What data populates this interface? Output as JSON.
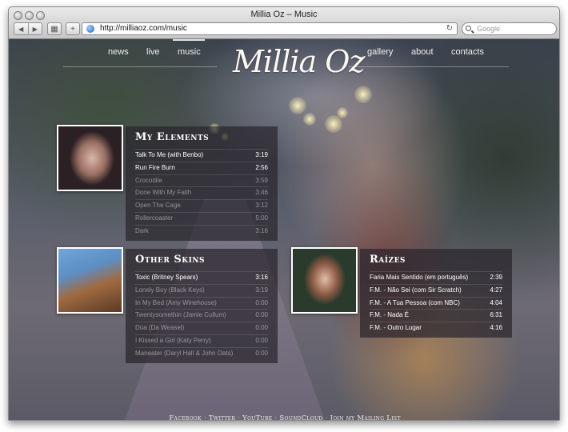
{
  "window": {
    "title": "Millia Oz – Music"
  },
  "toolbar": {
    "back_icon": "back-arrow-icon",
    "forward_icon": "forward-arrow-icon",
    "grid_icon": "grid-icon",
    "add_symbol": "+",
    "url": "http://milliaoz.com/music",
    "search_placeholder": "Google"
  },
  "site": {
    "logo": "Millia Oz",
    "nav_left": [
      "news",
      "live",
      "music"
    ],
    "nav_right": [
      "gallery",
      "about",
      "contacts"
    ],
    "active": "music"
  },
  "albums": [
    {
      "title": "My Elements",
      "tracks": [
        {
          "name": "Talk To Me (with Benbo)",
          "duration": "3:19",
          "bright": true
        },
        {
          "name": "Run Fire Burn",
          "duration": "2:56",
          "bright": true
        },
        {
          "name": "Crocodile",
          "duration": "3:59",
          "bright": false
        },
        {
          "name": "Done With My Faith",
          "duration": "3:46",
          "bright": false
        },
        {
          "name": "Open The Cage",
          "duration": "3:12",
          "bright": false
        },
        {
          "name": "Rollercoaster",
          "duration": "5:00",
          "bright": false
        },
        {
          "name": "Dark",
          "duration": "3:16",
          "bright": false
        }
      ]
    },
    {
      "title": "Other Skins",
      "tracks": [
        {
          "name": "Toxic (Britney Spears)",
          "duration": "3:16",
          "bright": true
        },
        {
          "name": "Lonely Boy (Black Keys)",
          "duration": "3:19",
          "bright": false
        },
        {
          "name": "In My Bed (Amy Winehouse)",
          "duration": "0:00",
          "bright": false
        },
        {
          "name": "Twentysomethin (Jamie Cullum)",
          "duration": "0:00",
          "bright": false
        },
        {
          "name": "Dúa (Da Weasel)",
          "duration": "0:00",
          "bright": false
        },
        {
          "name": "I Kissed a Girl (Katy Perry)",
          "duration": "0:00",
          "bright": false
        },
        {
          "name": "Maneater (Daryl Hall & John Oats)",
          "duration": "0:00",
          "bright": false
        }
      ]
    },
    {
      "title": "Raízes",
      "tracks": [
        {
          "name": "Faria Mais Sentido (em português)",
          "duration": "2:39",
          "bright": true
        },
        {
          "name": "F.M. - Não Sei (com Sir Scratch)",
          "duration": "4:27",
          "bright": true
        },
        {
          "name": "F.M. - A Tua Pessoa (com NBC)",
          "duration": "4:04",
          "bright": true
        },
        {
          "name": "F.M. - Nada É",
          "duration": "6:31",
          "bright": true
        },
        {
          "name": "F.M. - Outro Lugar",
          "duration": "4:16",
          "bright": true
        }
      ]
    }
  ],
  "footer": {
    "links": [
      "Facebook",
      "Twitter",
      "YouTube",
      "SoundCloud",
      "Join my Mailing List"
    ],
    "separator": "·"
  }
}
